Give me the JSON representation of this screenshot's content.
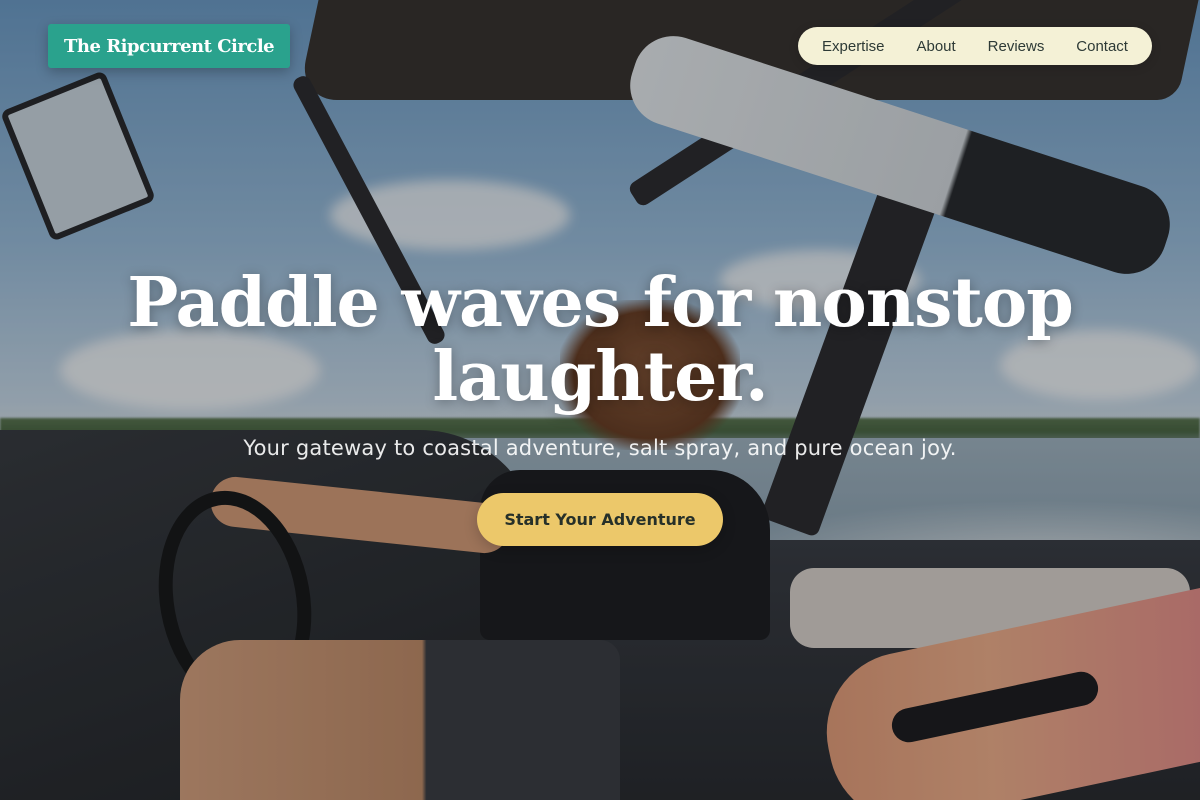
{
  "brand": {
    "name": "The Ripcurrent Circle"
  },
  "nav": {
    "items": [
      {
        "label": "Expertise"
      },
      {
        "label": "About"
      },
      {
        "label": "Reviews"
      },
      {
        "label": "Contact"
      }
    ]
  },
  "hero": {
    "headline": "Paddle waves for nonstop laughter.",
    "subheadline": "Your gateway to coastal adventure, salt spray, and pure ocean joy.",
    "cta_label": "Start Your Adventure",
    "background_icon": "photo-wakeboard-boat"
  },
  "colors": {
    "logo_bg": "#2aa28d",
    "nav_bg": "#f4f1d6",
    "cta_bg": "#ecc86a",
    "headline": "#ffffff"
  }
}
